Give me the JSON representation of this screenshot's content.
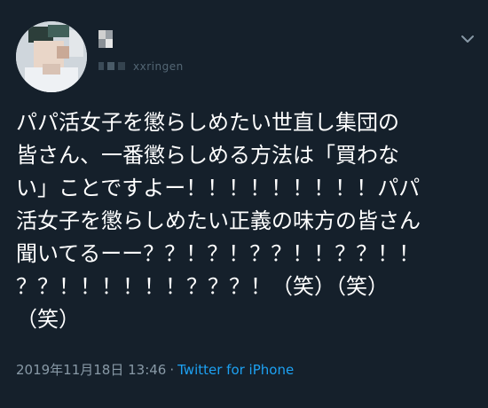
{
  "colors": {
    "background": "#15202b",
    "text": "#ffffff",
    "muted": "#8899a6",
    "link": "#1da1f2"
  },
  "author": {
    "handle_fragment": "xxringen"
  },
  "tweet": {
    "lines": [
      "パパ活女子を懲らしめたい世直し集団の",
      "皆さん、一番懲らしめる方法は「買わな",
      "い」ことですよー！！！！！！！！！パパ",
      "活女子を懲らしめたい正義の味方の皆さん",
      "聞いてるーー？？！？！？？！！？？！！",
      "？？！！！！！！？？？！（笑）（笑）",
      "（笑）"
    ],
    "date": "2019年11月18日 13:46",
    "separator": "·",
    "source": "Twitter for iPhone"
  },
  "icons": {
    "more": "chevron-down-icon"
  }
}
